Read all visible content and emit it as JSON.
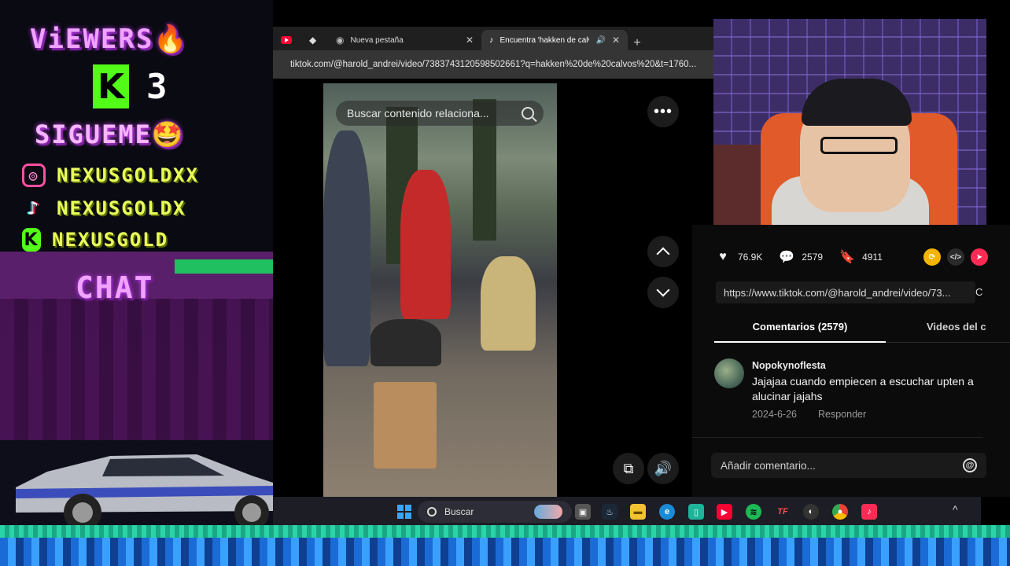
{
  "overlay": {
    "viewers_label": "ViEWERS",
    "viewers_emoji": "🔥",
    "kick_letter": "K",
    "viewer_count": "3",
    "follow_label": "SIGUEME",
    "follow_emoji": "🤩",
    "socials": [
      {
        "icon": "instagram-icon",
        "name": "NEXUSGOLDXX"
      },
      {
        "icon": "tiktok-icon",
        "name": "NEXUSGOLDX"
      },
      {
        "icon": "kick-icon",
        "name": "NEXUSGOLD"
      }
    ],
    "chat_label": "CHAT",
    "accent": "#f0a3ff",
    "kick_color": "#53fc18"
  },
  "browser": {
    "tabs": [
      {
        "icon": "youtube-icon",
        "label": ""
      },
      {
        "icon": "diamond-icon",
        "label": ""
      },
      {
        "icon": "chrome-icon",
        "label": "Nueva pestaña",
        "close": "✕"
      },
      {
        "icon": "tiktok-icon",
        "label": "Encuentra 'hakken de calvo",
        "close": "✕"
      }
    ],
    "new_tab": "+",
    "url": "tiktok.com/@harold_andrei/video/7383743120598502661?q=hakken%20de%20calvos%20&t=1760..."
  },
  "video": {
    "search_placeholder": "Buscar contenido relaciona..."
  },
  "controls": {
    "more": "•••",
    "volume": "🔊",
    "pip": "⧉"
  },
  "stats": {
    "likes": "76.9K",
    "comments": "2579",
    "saves": "4911"
  },
  "share_url": "https://www.tiktok.com/@harold_andrei/video/73...",
  "share_url_tail": "C",
  "tabs": {
    "comments": "Comentarios (2579)",
    "creator_videos": "Videos del c"
  },
  "comment": {
    "user": "Nopokynoflesta",
    "text": "Jajajaa cuando empiecen a escuchar upten a alucinar jajahs",
    "date": "2024-6-26",
    "reply": "Responder"
  },
  "add_comment_placeholder": "Añadir comentario...",
  "at_symbol": "@",
  "taskbar": {
    "search_label": "Buscar",
    "apps": [
      "task-view-icon",
      "steam-icon",
      "folder-icon",
      "edge-icon",
      "phone-link-icon",
      "youtube-icon",
      "spotify-icon",
      "tf-icon",
      "obs-icon",
      "chrome-icon",
      "tiktok-icon"
    ],
    "chevron": "^"
  }
}
